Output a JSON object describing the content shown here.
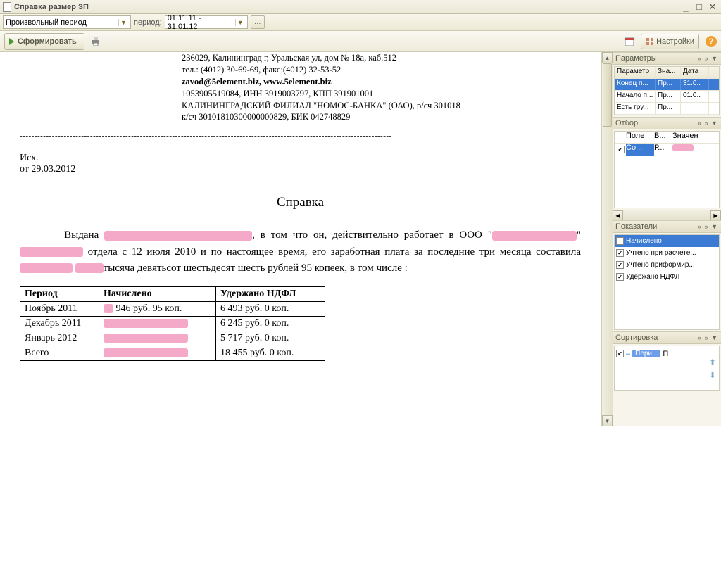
{
  "window": {
    "title": "Справка размер ЗП"
  },
  "toolbar": {
    "period_type": "Произвольный период",
    "period_label": "период:",
    "period_value": "01.11.11 - 31.01.12",
    "generate": "Сформировать",
    "settings": "Настройки"
  },
  "document": {
    "header": {
      "addr": "236029, Калининград г, Уральская ул, дом № 18а, каб.512",
      "phone": "тел.: (4012) 30-69-69, факс:(4012) 32-53-52",
      "email": "zavod@5element.biz, www.5element.biz",
      "inn": "1053905519084, ИНН 3919003797, КПП 391901001",
      "bank1": "КАЛИНИНГРАДСКИЙ ФИЛИАЛ \"НОМОС-БАНКА\" (ОАО), р/сч 301018",
      "bank2": "к/сч 30101810300000000829, БИК 042748829"
    },
    "ref1": "Исх.",
    "ref2": "от 29.03.2012",
    "title": "Справка",
    "body_prefix": "Выдана ",
    "body_mid1": ", в том что он, действительно работает в ООО \"",
    "body_mid2": "\" ",
    "body_mid3": " отдела с 12 июля 2010 и по настоящее время, его заработная плата за последние три месяца составила",
    "body_suffix": "тысяча девятьсот шестьдесят шесть рублей 95 копеек, в том числе :",
    "table": {
      "headers": [
        "Период",
        "Начислено",
        "Удержано НДФЛ"
      ],
      "rows": [
        {
          "period": "Ноябрь 2011",
          "accrued_suffix": "946 руб.  95 коп.",
          "tax": "6 493 руб.  0 коп."
        },
        {
          "period": "Декабрь 2011",
          "accrued_suffix": "",
          "tax": "6 245 руб.  0 коп."
        },
        {
          "period": "Январь 2012",
          "accrued_suffix": "",
          "tax": "5 717 руб.  0 коп."
        },
        {
          "period": "Всего",
          "accrued_suffix": "",
          "tax": "18 455 руб. 0 коп."
        }
      ]
    }
  },
  "panels": {
    "params": {
      "title": "Параметры",
      "cols": [
        "Параметр",
        "Зна...",
        "Дата"
      ],
      "rows": [
        {
          "p": "Конец п...",
          "v": "Пр...",
          "d": "31.0..",
          "sel": true
        },
        {
          "p": "Начало п...",
          "v": "Пр...",
          "d": "01.0.."
        },
        {
          "p": "Есть гру...",
          "v": "Пр...",
          "d": ""
        }
      ]
    },
    "filter": {
      "title": "Отбор",
      "cols": [
        "",
        "Поле",
        "В...",
        "Значен"
      ],
      "row": {
        "checked": true,
        "field": "Со...",
        "op": "Р...",
        "val": ""
      }
    },
    "indicators": {
      "title": "Показатели",
      "items": [
        {
          "label": "Начислено",
          "sel": true
        },
        {
          "label": "Учтено при расчете..."
        },
        {
          "label": "Учтено приформир..."
        },
        {
          "label": "Удержано НДФЛ"
        }
      ]
    },
    "sort": {
      "title": "Сортировка",
      "item": "Пери...",
      "suffix": "П"
    }
  }
}
